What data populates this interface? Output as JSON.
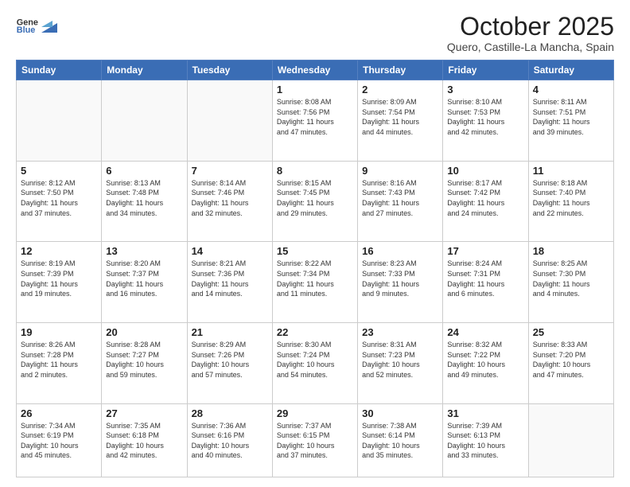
{
  "header": {
    "logo_general": "General",
    "logo_blue": "Blue",
    "title": "October 2025",
    "subtitle": "Quero, Castille-La Mancha, Spain"
  },
  "weekdays": [
    "Sunday",
    "Monday",
    "Tuesday",
    "Wednesday",
    "Thursday",
    "Friday",
    "Saturday"
  ],
  "weeks": [
    [
      {
        "day": "",
        "info": ""
      },
      {
        "day": "",
        "info": ""
      },
      {
        "day": "",
        "info": ""
      },
      {
        "day": "1",
        "info": "Sunrise: 8:08 AM\nSunset: 7:56 PM\nDaylight: 11 hours\nand 47 minutes."
      },
      {
        "day": "2",
        "info": "Sunrise: 8:09 AM\nSunset: 7:54 PM\nDaylight: 11 hours\nand 44 minutes."
      },
      {
        "day": "3",
        "info": "Sunrise: 8:10 AM\nSunset: 7:53 PM\nDaylight: 11 hours\nand 42 minutes."
      },
      {
        "day": "4",
        "info": "Sunrise: 8:11 AM\nSunset: 7:51 PM\nDaylight: 11 hours\nand 39 minutes."
      }
    ],
    [
      {
        "day": "5",
        "info": "Sunrise: 8:12 AM\nSunset: 7:50 PM\nDaylight: 11 hours\nand 37 minutes."
      },
      {
        "day": "6",
        "info": "Sunrise: 8:13 AM\nSunset: 7:48 PM\nDaylight: 11 hours\nand 34 minutes."
      },
      {
        "day": "7",
        "info": "Sunrise: 8:14 AM\nSunset: 7:46 PM\nDaylight: 11 hours\nand 32 minutes."
      },
      {
        "day": "8",
        "info": "Sunrise: 8:15 AM\nSunset: 7:45 PM\nDaylight: 11 hours\nand 29 minutes."
      },
      {
        "day": "9",
        "info": "Sunrise: 8:16 AM\nSunset: 7:43 PM\nDaylight: 11 hours\nand 27 minutes."
      },
      {
        "day": "10",
        "info": "Sunrise: 8:17 AM\nSunset: 7:42 PM\nDaylight: 11 hours\nand 24 minutes."
      },
      {
        "day": "11",
        "info": "Sunrise: 8:18 AM\nSunset: 7:40 PM\nDaylight: 11 hours\nand 22 minutes."
      }
    ],
    [
      {
        "day": "12",
        "info": "Sunrise: 8:19 AM\nSunset: 7:39 PM\nDaylight: 11 hours\nand 19 minutes."
      },
      {
        "day": "13",
        "info": "Sunrise: 8:20 AM\nSunset: 7:37 PM\nDaylight: 11 hours\nand 16 minutes."
      },
      {
        "day": "14",
        "info": "Sunrise: 8:21 AM\nSunset: 7:36 PM\nDaylight: 11 hours\nand 14 minutes."
      },
      {
        "day": "15",
        "info": "Sunrise: 8:22 AM\nSunset: 7:34 PM\nDaylight: 11 hours\nand 11 minutes."
      },
      {
        "day": "16",
        "info": "Sunrise: 8:23 AM\nSunset: 7:33 PM\nDaylight: 11 hours\nand 9 minutes."
      },
      {
        "day": "17",
        "info": "Sunrise: 8:24 AM\nSunset: 7:31 PM\nDaylight: 11 hours\nand 6 minutes."
      },
      {
        "day": "18",
        "info": "Sunrise: 8:25 AM\nSunset: 7:30 PM\nDaylight: 11 hours\nand 4 minutes."
      }
    ],
    [
      {
        "day": "19",
        "info": "Sunrise: 8:26 AM\nSunset: 7:28 PM\nDaylight: 11 hours\nand 2 minutes."
      },
      {
        "day": "20",
        "info": "Sunrise: 8:28 AM\nSunset: 7:27 PM\nDaylight: 10 hours\nand 59 minutes."
      },
      {
        "day": "21",
        "info": "Sunrise: 8:29 AM\nSunset: 7:26 PM\nDaylight: 10 hours\nand 57 minutes."
      },
      {
        "day": "22",
        "info": "Sunrise: 8:30 AM\nSunset: 7:24 PM\nDaylight: 10 hours\nand 54 minutes."
      },
      {
        "day": "23",
        "info": "Sunrise: 8:31 AM\nSunset: 7:23 PM\nDaylight: 10 hours\nand 52 minutes."
      },
      {
        "day": "24",
        "info": "Sunrise: 8:32 AM\nSunset: 7:22 PM\nDaylight: 10 hours\nand 49 minutes."
      },
      {
        "day": "25",
        "info": "Sunrise: 8:33 AM\nSunset: 7:20 PM\nDaylight: 10 hours\nand 47 minutes."
      }
    ],
    [
      {
        "day": "26",
        "info": "Sunrise: 7:34 AM\nSunset: 6:19 PM\nDaylight: 10 hours\nand 45 minutes."
      },
      {
        "day": "27",
        "info": "Sunrise: 7:35 AM\nSunset: 6:18 PM\nDaylight: 10 hours\nand 42 minutes."
      },
      {
        "day": "28",
        "info": "Sunrise: 7:36 AM\nSunset: 6:16 PM\nDaylight: 10 hours\nand 40 minutes."
      },
      {
        "day": "29",
        "info": "Sunrise: 7:37 AM\nSunset: 6:15 PM\nDaylight: 10 hours\nand 37 minutes."
      },
      {
        "day": "30",
        "info": "Sunrise: 7:38 AM\nSunset: 6:14 PM\nDaylight: 10 hours\nand 35 minutes."
      },
      {
        "day": "31",
        "info": "Sunrise: 7:39 AM\nSunset: 6:13 PM\nDaylight: 10 hours\nand 33 minutes."
      },
      {
        "day": "",
        "info": ""
      }
    ]
  ]
}
